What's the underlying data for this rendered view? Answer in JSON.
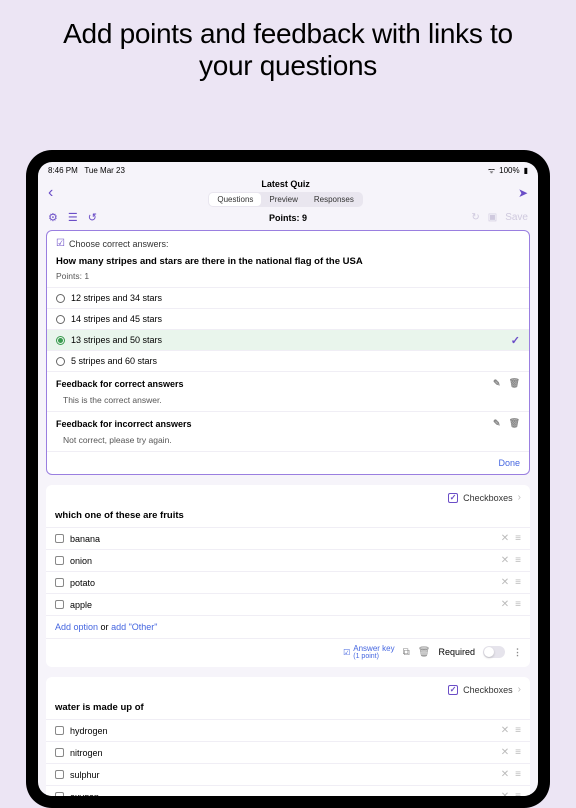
{
  "promo": {
    "title": "Add points and feedback with links to your questions"
  },
  "status": {
    "time": "8:46 PM",
    "date": "Tue Mar 23",
    "battery": "100%"
  },
  "header": {
    "title": "Latest Quiz",
    "tabs": [
      "Questions",
      "Preview",
      "Responses"
    ]
  },
  "toolbar": {
    "points_label": "Points: 9",
    "save": "Save"
  },
  "q1": {
    "choose_label": "Choose correct answers:",
    "question": "How many stripes and stars are there in the national flag of the USA",
    "points": "Points: 1",
    "options": [
      "12 stripes and 34 stars",
      "14 stripes and 45 stars",
      "13 stripes and 50 stars",
      "5 stripes and 60 stars"
    ],
    "feedback_correct_label": "Feedback for correct answers",
    "feedback_correct": "This is the correct answer.",
    "feedback_incorrect_label": "Feedback for incorrect answers",
    "feedback_incorrect": "Not correct, please try again.",
    "done": "Done"
  },
  "q2": {
    "type": "Checkboxes",
    "question": "which one of these are fruits",
    "options": [
      "banana",
      "onion",
      "potato",
      "apple"
    ],
    "add_option": "Add option",
    "or": " or ",
    "add_other": "add \"Other\"",
    "answer_key": "Answer key",
    "answer_key_pts": "(1 point)",
    "required": "Required"
  },
  "q3": {
    "type": "Checkboxes",
    "question": "water is made up of",
    "options": [
      "hydrogen",
      "nitrogen",
      "sulphur",
      "oxygen"
    ]
  }
}
